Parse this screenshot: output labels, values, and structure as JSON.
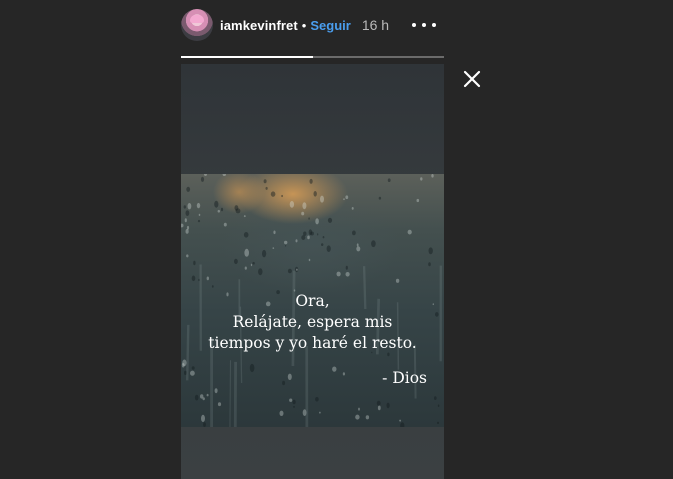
{
  "header": {
    "username": "iamkevinfret",
    "separator": "•",
    "follow_label": "Seguir",
    "time": "16 h"
  },
  "progress": {
    "segments": 2,
    "current": 1
  },
  "story": {
    "quote_lines": [
      "Ora,",
      "Relájate, espera mis",
      "tiempos y yo haré el resto."
    ],
    "signature": "- Dios"
  },
  "icons": {
    "more": "more-horizontal-icon",
    "close": "close-icon"
  },
  "colors": {
    "background": "#262626",
    "follow": "#4a9eef",
    "progress_active": "#ffffff",
    "progress_inactive": "#6b6b6b"
  }
}
